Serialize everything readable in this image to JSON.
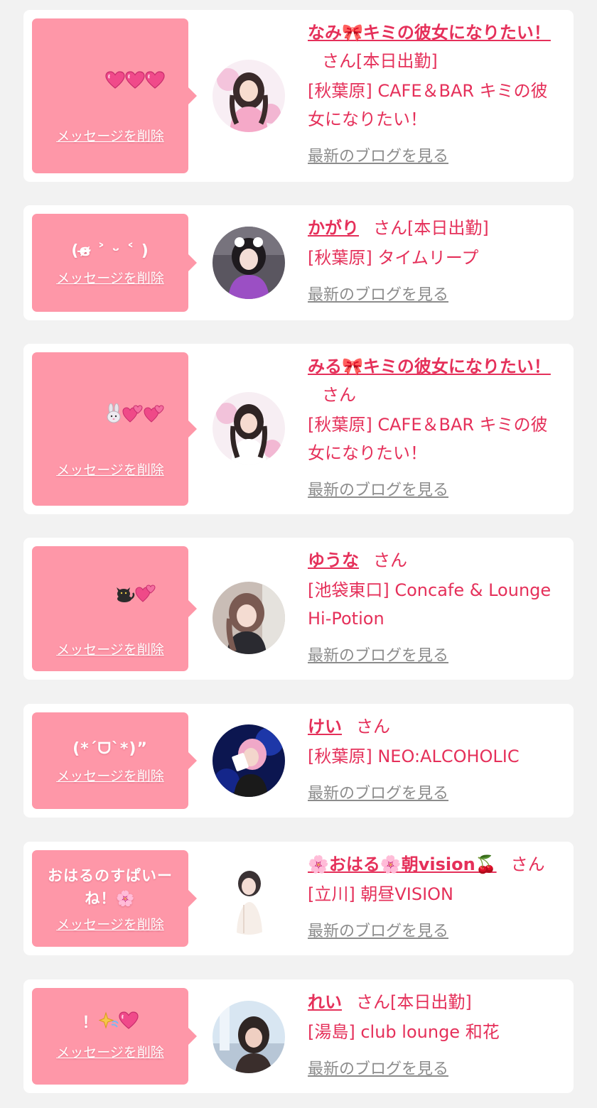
{
  "common": {
    "delete_label": "メッセージを削除",
    "blog_label": "最新のブログを見る",
    "san_label": "さん"
  },
  "cards": [
    {
      "message_text": "",
      "message_icons": [
        "heart-icon",
        "heart-icon",
        "heart-icon"
      ],
      "name": "なみ🎀キミの彼女になりたい！",
      "suffix": "さん[本日出勤]",
      "shop": "[秋葉原] CAFE＆BAR キミの彼女になりたい！"
    },
    {
      "message_text": "(ɞ̴̶̷ ˃ ᵕ ˂ )",
      "message_icons": [],
      "name": "かがり",
      "suffix": "さん[本日出勤]",
      "shop": "[秋葉原] タイムリープ"
    },
    {
      "message_text": "",
      "message_icons": [
        "rabbit-icon",
        "two-hearts-icon",
        "two-hearts-icon"
      ],
      "name": "みる🎀キミの彼女になりたい！",
      "suffix": "さん",
      "shop": "[秋葉原] CAFE＆BAR キミの彼女になりたい！"
    },
    {
      "message_text": "",
      "message_icons": [
        "black-cat-icon",
        "two-hearts-icon"
      ],
      "name": "ゆうな",
      "suffix": "さん",
      "shop": "[池袋東口] Concafe & Lounge Hi-Potion"
    },
    {
      "message_text": "(*ˊᗜˋ*)”",
      "message_icons": [],
      "name": "けい",
      "suffix": "さん",
      "shop": "[秋葉原] NEO:ALCOHOLIC"
    },
    {
      "message_text": "おはるのすぱいーね！🌸",
      "message_icons": [],
      "name": "🌸おはる🌸朝vision🍒",
      "suffix": "さん",
      "shop": "[立川] 朝昼VISION"
    },
    {
      "message_text": "！",
      "message_icons": [
        "sparkle-icon",
        "heart-icon"
      ],
      "name": "れい",
      "suffix": "さん[本日出勤]",
      "shop": "[湯島] club lounge 和花"
    }
  ],
  "colors": {
    "bubble": "#fe97a8",
    "name": "#e5305a",
    "blog": "#8c8c8c",
    "background": "#f2f2f2"
  }
}
